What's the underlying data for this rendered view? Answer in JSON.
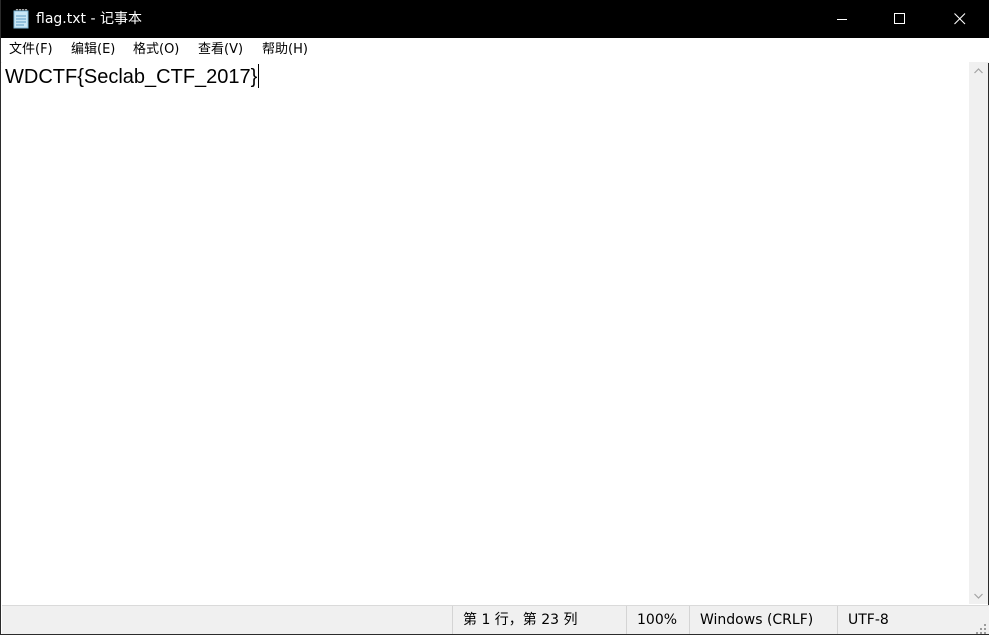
{
  "window": {
    "title": "flag.txt - 记事本",
    "icon": "notepad-icon"
  },
  "caption_buttons": {
    "minimize": "minimize-icon",
    "maximize": "maximize-icon",
    "close": "close-icon"
  },
  "menu": {
    "items": [
      {
        "label": "文件(F)"
      },
      {
        "label": "编辑(E)"
      },
      {
        "label": "格式(O)"
      },
      {
        "label": "查看(V)"
      },
      {
        "label": "帮助(H)"
      }
    ]
  },
  "editor": {
    "content": "WDCTF{Seclab_CTF_2017}"
  },
  "statusbar": {
    "position": "第 1 行，第 23 列",
    "zoom": "100%",
    "line_ending": "Windows (CRLF)",
    "encoding": "UTF-8"
  },
  "colors": {
    "titlebar_bg": "#000000",
    "titlebar_text": "#ffffff",
    "statusbar_bg": "#f0f0f0"
  }
}
